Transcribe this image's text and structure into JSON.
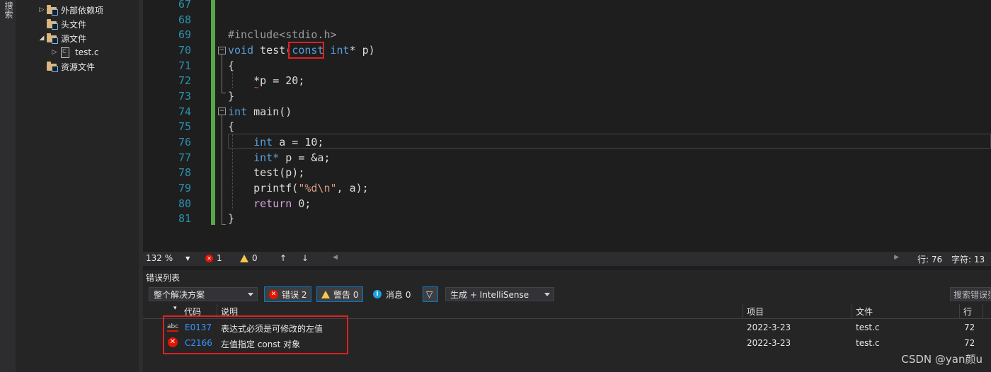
{
  "side_strip": {
    "label": "搜索"
  },
  "tree": {
    "items": [
      {
        "label": "外部依赖项",
        "arrow": "▷"
      },
      {
        "label": "头文件",
        "arrow": ""
      },
      {
        "label": "源文件",
        "arrow": "◢"
      },
      {
        "label": "test.c",
        "arrow": "▷"
      },
      {
        "label": "资源文件",
        "arrow": ""
      }
    ]
  },
  "editor": {
    "line_numbers": [
      "67",
      "68",
      "69",
      "70",
      "71",
      "72",
      "73",
      "74",
      "75",
      "76",
      "77",
      "78",
      "79",
      "80",
      "81"
    ],
    "code": {
      "l69": "#include<stdio.h>",
      "l70_kw": "void",
      "l70_fn": "test",
      "l70_const": "const",
      "l70_rest": "int* p)",
      "l71": "{",
      "l72": "*p = 20;",
      "l73": "}",
      "l74_kw": "int",
      "l74_rest": "main()",
      "l75": "{",
      "l76_kw": "int",
      "l76_rest": "a = 10;",
      "l77_kw": "int*",
      "l77_rest": "p = &a;",
      "l78": "test(p);",
      "l79_fn": "printf(",
      "l79_str": "\"%d\\n\"",
      "l79_rest": ", a);",
      "l80_kw": "return",
      "l80_rest": "0;",
      "l81": "}"
    }
  },
  "statusbar": {
    "zoom": "132 %",
    "errors": "1",
    "warnings": "0",
    "up": "↑",
    "down": "↓",
    "line": "行: 76",
    "col": "字符: 13"
  },
  "error_list": {
    "title": "错误列表",
    "scope": "整个解决方案",
    "errors_btn": "错误 2",
    "warnings_btn": "警告 0",
    "messages_btn": "消息 0",
    "build_filter": "生成 + IntelliSense",
    "search_placeholder": "搜索错误列表",
    "columns": {
      "code": "代码",
      "desc": "说明",
      "project": "项目",
      "file": "文件",
      "line": "行"
    },
    "rows": [
      {
        "code": "E0137",
        "desc": "表达式必须是可修改的左值",
        "project": "2022-3-23",
        "file": "test.c",
        "line": "72"
      },
      {
        "code": "C2166",
        "desc": "左值指定 const 对象",
        "project": "2022-3-23",
        "file": "test.c",
        "line": "72"
      }
    ]
  },
  "watermark": "CSDN @yan颜u",
  "colors": {
    "accent": "#007acc",
    "error": "#e51400",
    "highlight_box": "#e02020"
  }
}
